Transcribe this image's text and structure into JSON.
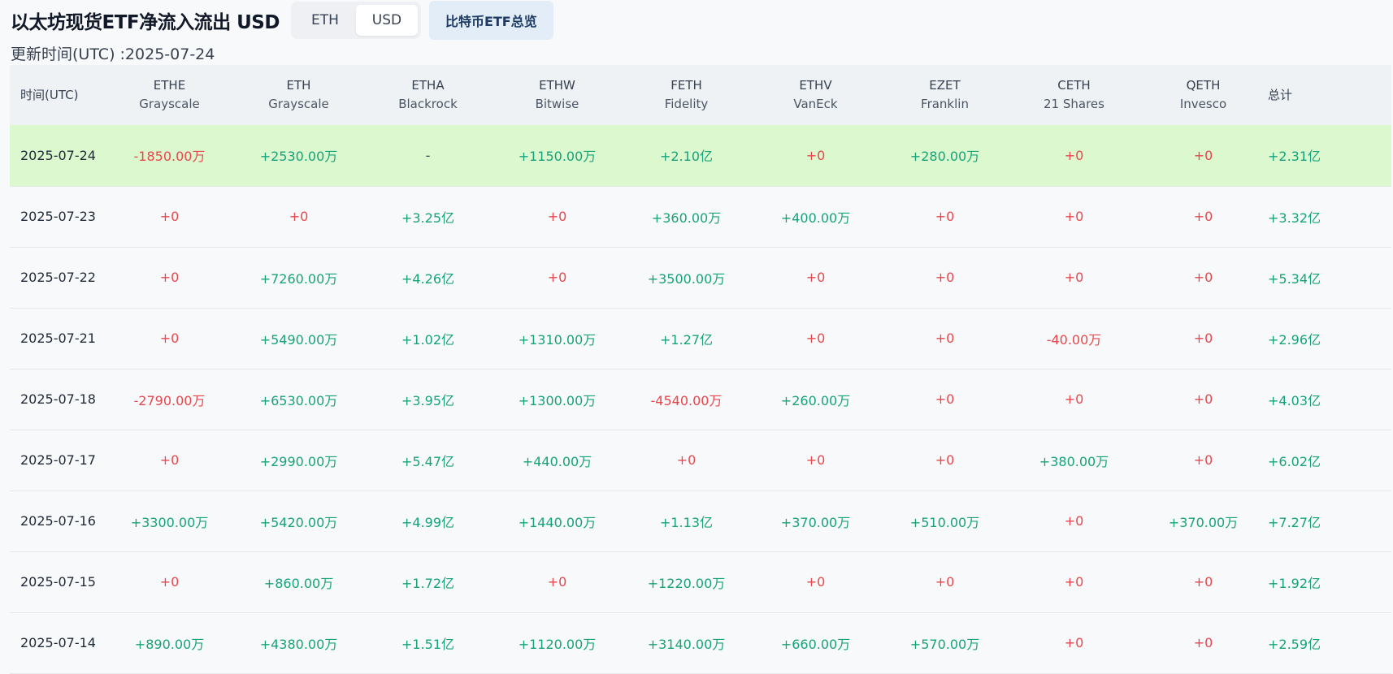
{
  "header": {
    "title": "以太坊现货ETF净流入流出 USD",
    "toggle": {
      "eth_label": "ETH",
      "usd_label": "USD",
      "active": "USD"
    },
    "btc_button_label": "比特币ETF总览",
    "updated_text": "更新时间(UTC) :2025-07-24"
  },
  "table": {
    "time_header": "时间(UTC)",
    "total_header": "总计",
    "columns": [
      {
        "ticker": "ETHE",
        "issuer": "Grayscale"
      },
      {
        "ticker": "ETH",
        "issuer": "Grayscale"
      },
      {
        "ticker": "ETHA",
        "issuer": "Blackrock"
      },
      {
        "ticker": "ETHW",
        "issuer": "Bitwise"
      },
      {
        "ticker": "FETH",
        "issuer": "Fidelity"
      },
      {
        "ticker": "ETHV",
        "issuer": "VanEck"
      },
      {
        "ticker": "EZET",
        "issuer": "Franklin"
      },
      {
        "ticker": "CETH",
        "issuer": "21 Shares"
      },
      {
        "ticker": "QETH",
        "issuer": "Invesco"
      }
    ],
    "rows": [
      {
        "date": "2025-07-24",
        "highlight": true,
        "values": [
          "-1850.00万",
          "+2530.00万",
          "-",
          "+1150.00万",
          "+2.10亿",
          "+0",
          "+280.00万",
          "+0",
          "+0"
        ],
        "total": "+2.31亿"
      },
      {
        "date": "2025-07-23",
        "highlight": false,
        "values": [
          "+0",
          "+0",
          "+3.25亿",
          "+0",
          "+360.00万",
          "+400.00万",
          "+0",
          "+0",
          "+0"
        ],
        "total": "+3.32亿"
      },
      {
        "date": "2025-07-22",
        "highlight": false,
        "values": [
          "+0",
          "+7260.00万",
          "+4.26亿",
          "+0",
          "+3500.00万",
          "+0",
          "+0",
          "+0",
          "+0"
        ],
        "total": "+5.34亿"
      },
      {
        "date": "2025-07-21",
        "highlight": false,
        "values": [
          "+0",
          "+5490.00万",
          "+1.02亿",
          "+1310.00万",
          "+1.27亿",
          "+0",
          "+0",
          "-40.00万",
          "+0"
        ],
        "total": "+2.96亿"
      },
      {
        "date": "2025-07-18",
        "highlight": false,
        "values": [
          "-2790.00万",
          "+6530.00万",
          "+3.95亿",
          "+1300.00万",
          "-4540.00万",
          "+260.00万",
          "+0",
          "+0",
          "+0"
        ],
        "total": "+4.03亿"
      },
      {
        "date": "2025-07-17",
        "highlight": false,
        "values": [
          "+0",
          "+2990.00万",
          "+5.47亿",
          "+440.00万",
          "+0",
          "+0",
          "+0",
          "+380.00万",
          "+0"
        ],
        "total": "+6.02亿"
      },
      {
        "date": "2025-07-16",
        "highlight": false,
        "values": [
          "+3300.00万",
          "+5420.00万",
          "+4.99亿",
          "+1440.00万",
          "+1.13亿",
          "+370.00万",
          "+510.00万",
          "+0",
          "+370.00万"
        ],
        "total": "+7.27亿"
      },
      {
        "date": "2025-07-15",
        "highlight": false,
        "values": [
          "+0",
          "+860.00万",
          "+1.72亿",
          "+0",
          "+1220.00万",
          "+0",
          "+0",
          "+0",
          "+0"
        ],
        "total": "+1.92亿"
      },
      {
        "date": "2025-07-14",
        "highlight": false,
        "values": [
          "+890.00万",
          "+4380.00万",
          "+1.51亿",
          "+1120.00万",
          "+3140.00万",
          "+660.00万",
          "+570.00万",
          "+0",
          "+0"
        ],
        "total": "+2.59亿"
      }
    ]
  },
  "colors": {
    "positive": "#17a37a",
    "negative": "#e5484d",
    "highlight_row": "#dcf8cf"
  }
}
